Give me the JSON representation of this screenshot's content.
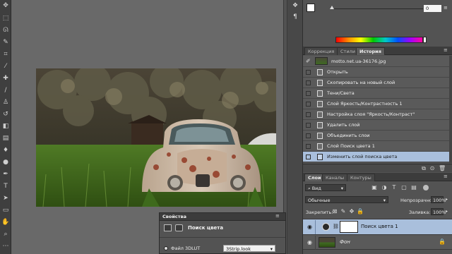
{
  "toolbar": {
    "tools": [
      "move-tool-icon",
      "marquee-tool-icon",
      "lasso-tool-icon",
      "quick-select-tool-icon",
      "crop-tool-icon",
      "eyedropper-tool-icon",
      "healing-brush-tool-icon",
      "brush-tool-icon",
      "clone-stamp-tool-icon",
      "history-brush-tool-icon",
      "eraser-tool-icon",
      "gradient-tool-icon",
      "blur-tool-icon",
      "dodge-tool-icon",
      "pen-tool-icon",
      "type-tool-icon",
      "path-select-tool-icon",
      "shape-tool-icon",
      "hand-tool-icon",
      "zoom-tool-icon"
    ]
  },
  "color_panel": {
    "slider_value": "0"
  },
  "history_panel": {
    "tabs": [
      "Коррекция",
      "Стили",
      "История"
    ],
    "snapshot_name": "motto.net.ua-36176.jpg",
    "items": [
      "Открыть",
      "Скопировать на новый слой",
      "Тени/Света",
      "Слой Яркость/Контрастность 1",
      "Настройка слоя \"Яркость/Контраст\"",
      "Удалить слой",
      "Объединить слои",
      "Слой Поиск цвета 1",
      "Изменить слой поиска цвета"
    ],
    "selected_index": 8
  },
  "layers_panel": {
    "tabs": [
      "Слои",
      "Каналы",
      "Контуры"
    ],
    "filter_label": "Вид",
    "blend_mode": "Обычные",
    "opacity_label": "Непрозрачность:",
    "opacity_value": "100%",
    "lock_label": "Закрепить:",
    "fill_label": "Заливка:",
    "fill_value": "100%",
    "layers": [
      {
        "name": "Поиск цвета 1",
        "selected": true
      },
      {
        "name": "Фон",
        "selected": false
      }
    ]
  },
  "properties_panel": {
    "title": "Свойства",
    "subtitle": "Поиск цвета",
    "option_label": "Файл 3DLUT",
    "option_value": "3Strip.look"
  }
}
